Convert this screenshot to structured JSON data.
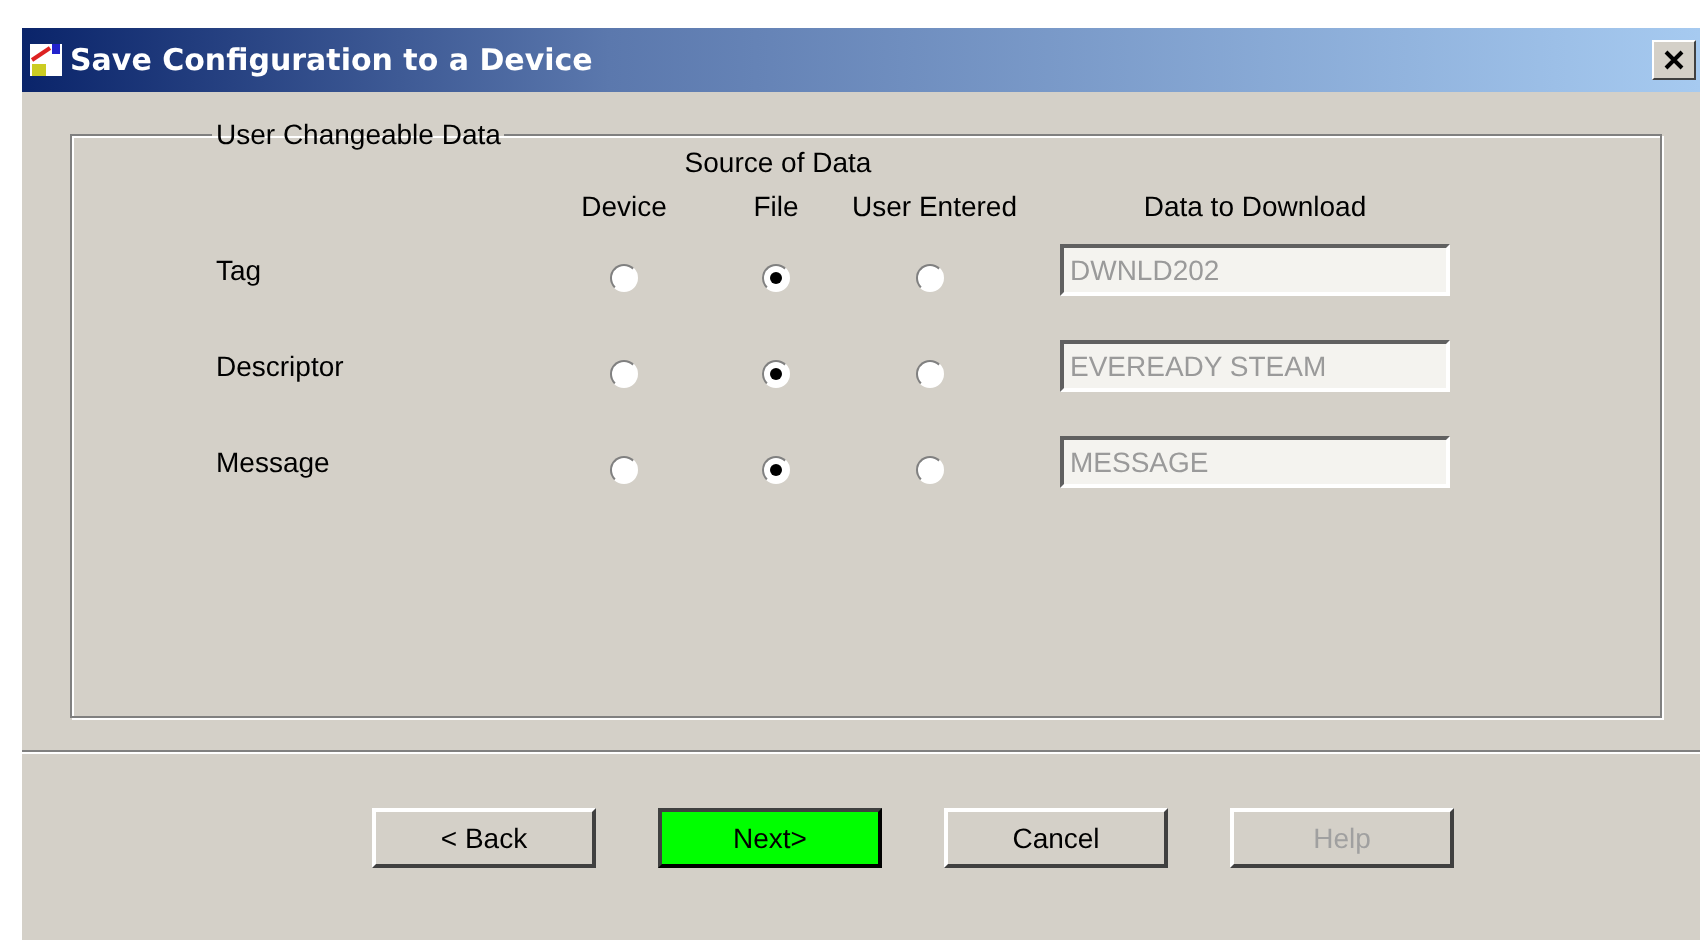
{
  "window": {
    "title": "Save Configuration to a Device"
  },
  "group": {
    "title": "User Changeable Data",
    "source_header": "Source of Data",
    "columns": [
      "Device",
      "File",
      "User Entered",
      "Data to Download"
    ],
    "rows": [
      {
        "label": "Tag",
        "options": [
          {
            "selected": false
          },
          {
            "selected": true
          },
          {
            "selected": false
          }
        ],
        "value": "DWNLD202",
        "disabled": true
      },
      {
        "label": "Descriptor",
        "options": [
          {
            "selected": false
          },
          {
            "selected": true
          },
          {
            "selected": false
          }
        ],
        "value": "EVEREADY STEAM",
        "disabled": true
      },
      {
        "label": "Message",
        "options": [
          {
            "selected": false
          },
          {
            "selected": true
          },
          {
            "selected": false
          }
        ],
        "value": "MESSAGE",
        "disabled": true
      }
    ]
  },
  "buttons": [
    {
      "label": "< Back",
      "highlighted": false,
      "disabled": false
    },
    {
      "label": "Next>",
      "highlighted": true,
      "disabled": false
    },
    {
      "label": "Cancel",
      "highlighted": false,
      "disabled": false
    },
    {
      "label": "Help",
      "highlighted": false,
      "disabled": true
    }
  ]
}
